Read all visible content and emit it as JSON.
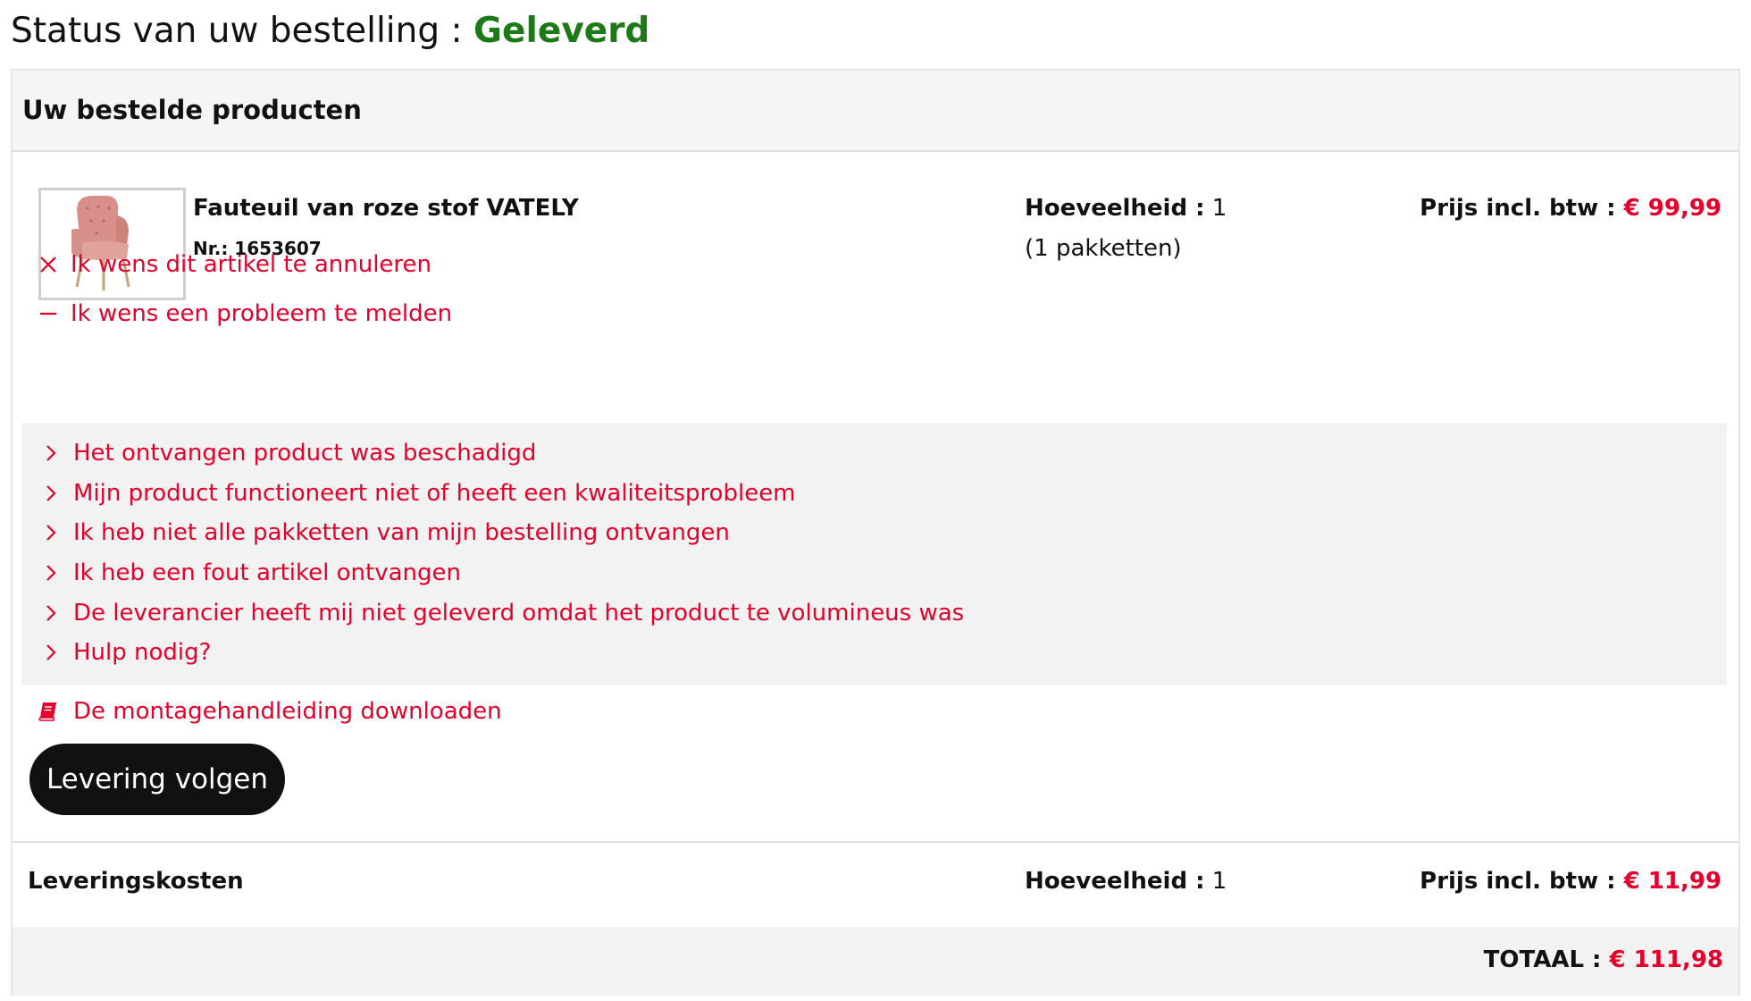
{
  "status": {
    "label": "Status van uw bestelling : ",
    "value": "Geleverd",
    "value_color": "#1b7a15"
  },
  "panel": {
    "title": "Uw bestelde producten"
  },
  "product": {
    "image_icon": "armchair-pink",
    "name": "Fauteuil van roze stof VATELY",
    "nr": "Nr.: 1653607",
    "qty_label": "Hoeveelheid :",
    "qty_value": " 1",
    "packages": "(1 pakketten)",
    "price_label": "Prijs incl. btw :",
    "price_value": " € 99,99"
  },
  "actions": {
    "cancel": "Ik wens dit artikel te annuleren",
    "cancel_icon": "close-x",
    "report": "Ik wens een probleem te melden",
    "report_icon": "minus",
    "problems": [
      "Het ontvangen product was beschadigd",
      "Mijn product functioneert niet of heeft een kwaliteitsprobleem",
      "Ik heb niet alle pakketten van mijn bestelling ontvangen",
      "Ik heb een fout artikel ontvangen",
      "De leverancier heeft mij niet geleverd omdat het product te volumineus was",
      "Hulp nodig?"
    ],
    "manual": "De montagehandleiding downloaden",
    "manual_icon": "book",
    "track_button": "Levering volgen"
  },
  "delivery": {
    "name": "Leveringskosten",
    "qty_label": "Hoeveelheid :",
    "qty_value": " 1",
    "price_label": "Prijs incl. btw :",
    "price_value": " € 11,99"
  },
  "total": {
    "label": "TOTAAL :",
    "value": " € 111,98"
  },
  "colors": {
    "accent_red": "#e4002b",
    "status_green": "#1b7a15",
    "button_dark": "#111111",
    "panel_bg": "#f5f5f5"
  }
}
